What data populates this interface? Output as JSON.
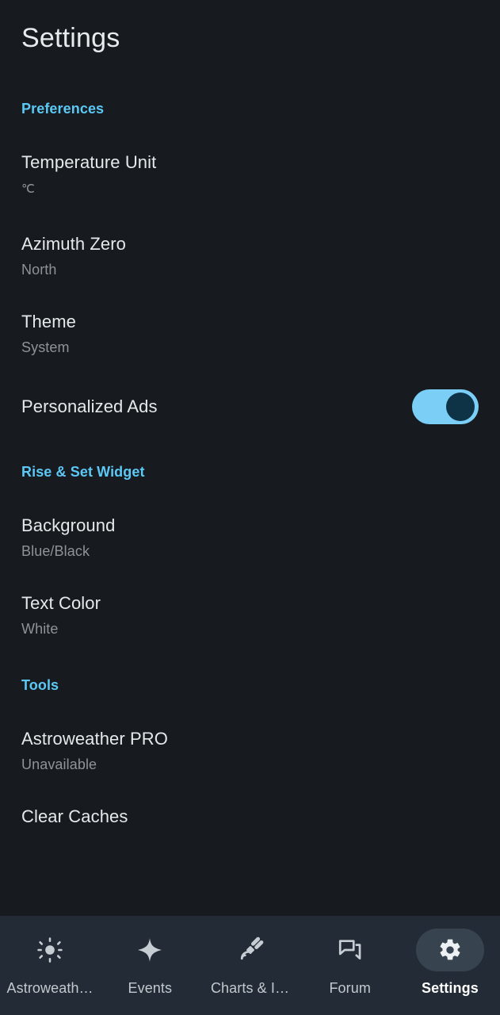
{
  "app": {
    "title": "Settings",
    "accent_color": "#5CC8F5",
    "background_color": "#171B1F",
    "nav_background_color": "#232C36",
    "active_pill_color": "#37444F",
    "toggle_on_track_color": "#7BCFF7",
    "toggle_on_thumb_color": "#0E3246"
  },
  "sections": [
    {
      "header": "Preferences",
      "items": [
        {
          "title": "Temperature Unit",
          "value": "℃",
          "type": "choice"
        },
        {
          "title": "Azimuth Zero",
          "value": "North",
          "type": "choice"
        },
        {
          "title": "Theme",
          "value": "System",
          "type": "choice"
        },
        {
          "title": "Personalized Ads",
          "value": "",
          "type": "switch",
          "checked": true
        }
      ]
    },
    {
      "header": "Rise & Set Widget",
      "items": [
        {
          "title": "Background",
          "value": "Blue/Black",
          "type": "choice"
        },
        {
          "title": "Text Color",
          "value": "White",
          "type": "choice"
        }
      ]
    },
    {
      "header": "Tools",
      "items": [
        {
          "title": "Astroweather PRO",
          "value": "Unavailable",
          "type": "choice"
        },
        {
          "title": "Clear Caches",
          "value": "",
          "type": "action"
        }
      ]
    }
  ],
  "bottom_nav": {
    "items": [
      {
        "label": "Astroweath…",
        "icon": "sun-icon",
        "active": false
      },
      {
        "label": "Events",
        "icon": "star-icon",
        "active": false
      },
      {
        "label": "Charts & I…",
        "icon": "satellite-icon",
        "active": false
      },
      {
        "label": "Forum",
        "icon": "chat-bubbles-icon",
        "active": false
      },
      {
        "label": "Settings",
        "icon": "gear-icon",
        "active": true
      }
    ]
  }
}
